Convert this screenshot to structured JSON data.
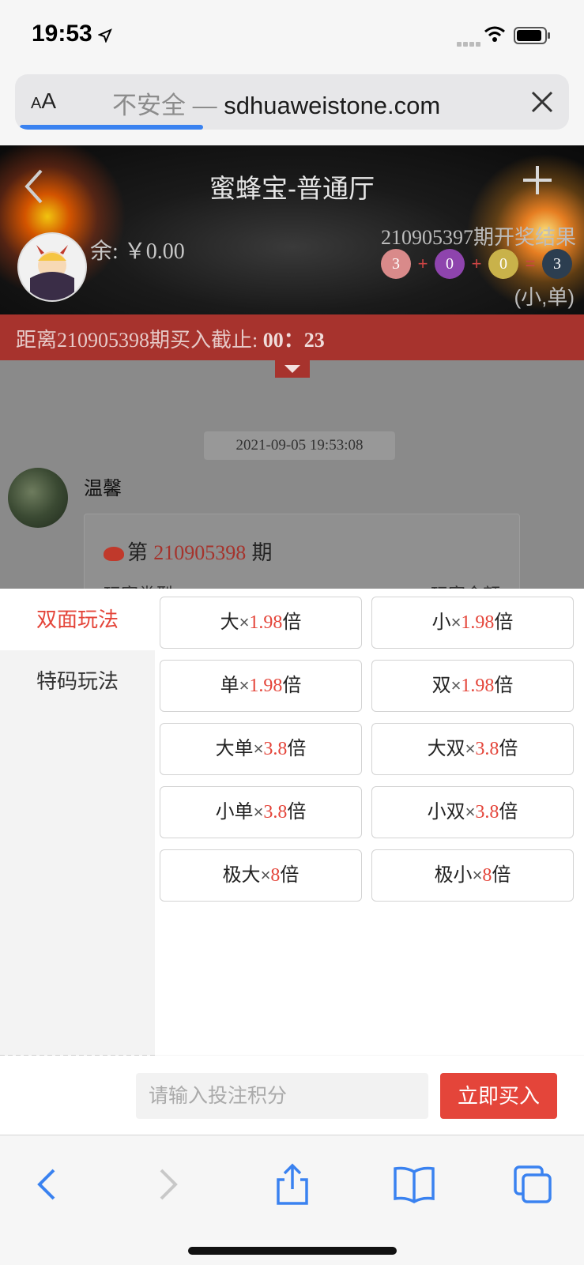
{
  "status_bar": {
    "time": "19:53"
  },
  "browser": {
    "aa_label": "AA",
    "insecure_label": "不安全",
    "dash": " — ",
    "domain": "sdhuaweistone.com"
  },
  "header": {
    "title": "蜜蜂宝-普通厅",
    "balance": "余: ￥0.00",
    "result_title": "210905397期开奖结果",
    "result_balls": [
      "3",
      "0",
      "0",
      "3"
    ],
    "result_ops": [
      "+",
      "+",
      "="
    ],
    "result_tag": "(小,单)",
    "ball_colors": [
      "#d98a8a",
      "#8e44ad",
      "#c9b24a",
      "#2c3e50"
    ]
  },
  "countdown": {
    "label": "距离210905398期买入截止: ",
    "time": "00：23"
  },
  "chat": {
    "timestamp": "2021-09-05 19:53:08",
    "username": "温馨",
    "message_prefix": "第",
    "message_issue": "210905398",
    "message_suffix": "期",
    "sub_left": "玩家类型",
    "sub_right": "玩家金额"
  },
  "bet_panel": {
    "tabs": [
      "双面玩法",
      "特码玩法"
    ],
    "active_tab": "双面玩法",
    "options": [
      {
        "name": "大",
        "mult": "1.98"
      },
      {
        "name": "小",
        "mult": "1.98"
      },
      {
        "name": "单",
        "mult": "1.98"
      },
      {
        "name": "双",
        "mult": "1.98"
      },
      {
        "name": "大单",
        "mult": "3.8"
      },
      {
        "name": "大双",
        "mult": "3.8"
      },
      {
        "name": "小单",
        "mult": "3.8"
      },
      {
        "name": "小双",
        "mult": "3.8"
      },
      {
        "name": "极大",
        "mult": "8"
      },
      {
        "name": "极小",
        "mult": "8"
      }
    ],
    "times_sign": "×",
    "unit": "倍"
  },
  "bet_input": {
    "placeholder": "请输入投注积分",
    "buy_label": "立即买入"
  },
  "colors": {
    "accent": "#e4453a",
    "countdown_bg": "#a7332d",
    "safari_blue": "#3a82f0"
  }
}
